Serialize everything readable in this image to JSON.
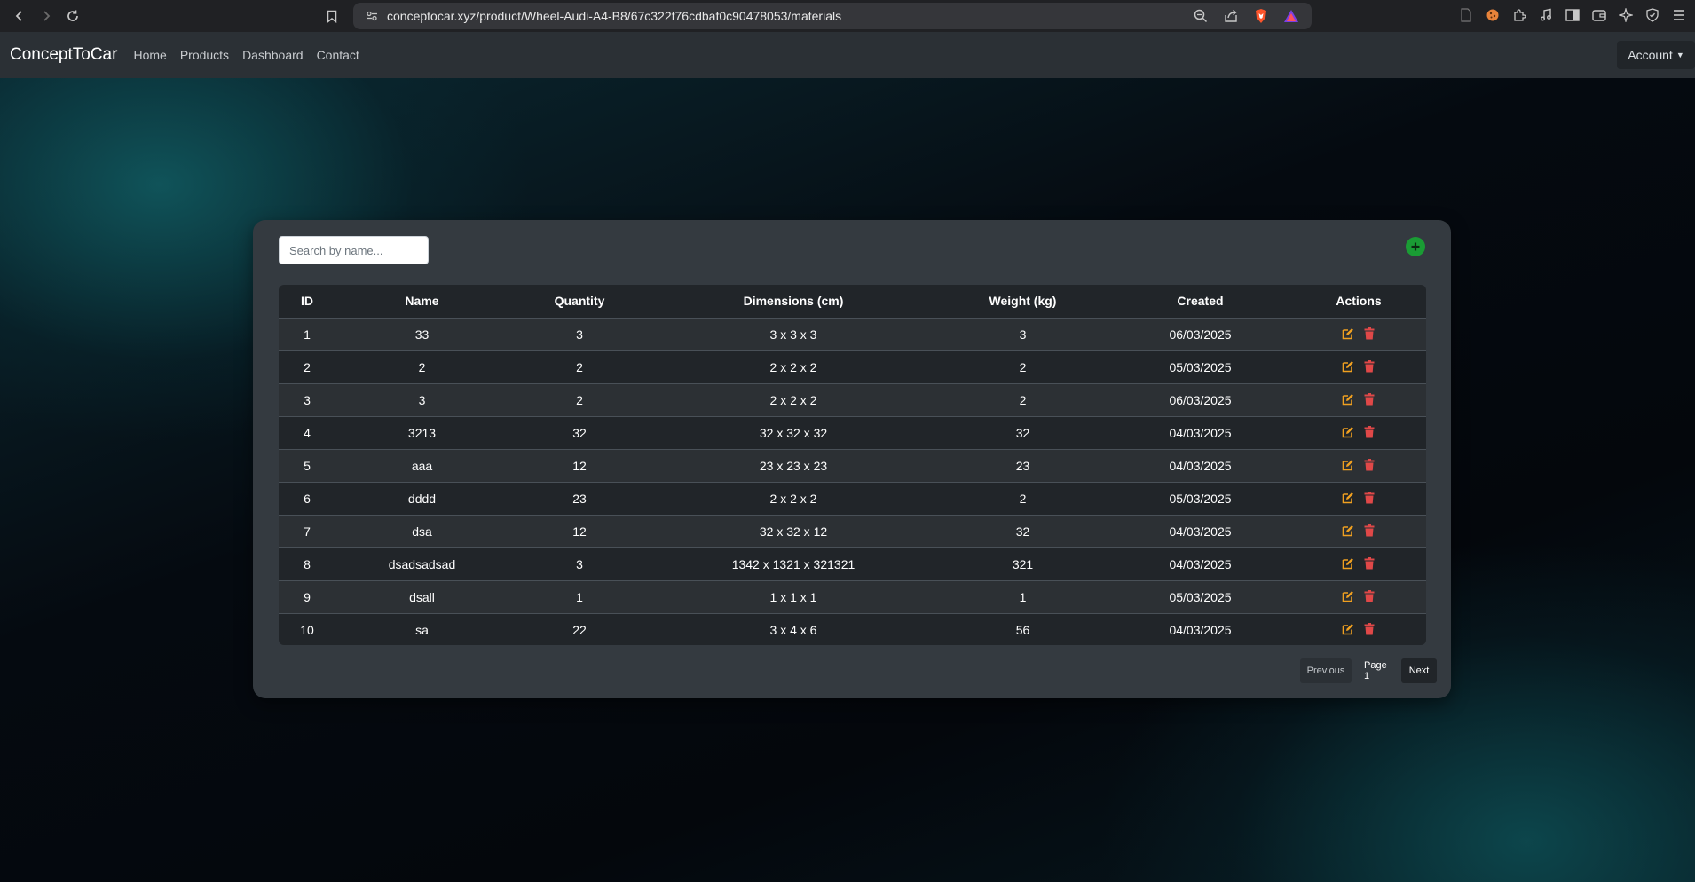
{
  "browser": {
    "url": "conceptocar.xyz/product/Wheel-Audi-A4-B8/67c322f76cdbaf0c90478053/materials"
  },
  "navbar": {
    "brand": "ConceptToCar",
    "links": [
      "Home",
      "Products",
      "Dashboard",
      "Contact"
    ],
    "account_label": "Account"
  },
  "materials": {
    "search_placeholder": "Search by name...",
    "columns": [
      "ID",
      "Name",
      "Quantity",
      "Dimensions (cm)",
      "Weight (kg)",
      "Created",
      "Actions"
    ],
    "rows": [
      {
        "id": "1",
        "name": "33",
        "quantity": "3",
        "dimensions": "3 x 3 x 3",
        "weight": "3",
        "created": "06/03/2025"
      },
      {
        "id": "2",
        "name": "2",
        "quantity": "2",
        "dimensions": "2 x 2 x 2",
        "weight": "2",
        "created": "05/03/2025"
      },
      {
        "id": "3",
        "name": "3",
        "quantity": "2",
        "dimensions": "2 x 2 x 2",
        "weight": "2",
        "created": "06/03/2025"
      },
      {
        "id": "4",
        "name": "3213",
        "quantity": "32",
        "dimensions": "32 x 32 x 32",
        "weight": "32",
        "created": "04/03/2025"
      },
      {
        "id": "5",
        "name": "aaa",
        "quantity": "12",
        "dimensions": "23 x 23 x 23",
        "weight": "23",
        "created": "04/03/2025"
      },
      {
        "id": "6",
        "name": "dddd",
        "quantity": "23",
        "dimensions": "2 x 2 x 2",
        "weight": "2",
        "created": "05/03/2025"
      },
      {
        "id": "7",
        "name": "dsa",
        "quantity": "12",
        "dimensions": "32 x 32 x 12",
        "weight": "32",
        "created": "04/03/2025"
      },
      {
        "id": "8",
        "name": "dsadsadsad",
        "quantity": "3",
        "dimensions": "1342 x 1321 x 321321",
        "weight": "321",
        "created": "04/03/2025"
      },
      {
        "id": "9",
        "name": "dsall",
        "quantity": "1",
        "dimensions": "1 x 1 x 1",
        "weight": "1",
        "created": "05/03/2025"
      },
      {
        "id": "10",
        "name": "sa",
        "quantity": "22",
        "dimensions": "3 x 4 x 6",
        "weight": "56",
        "created": "04/03/2025"
      }
    ],
    "pagination": {
      "previous_label": "Previous",
      "page_label": "Page 1",
      "next_label": "Next"
    }
  },
  "colors": {
    "edit_icon": "#f0a020",
    "delete_icon": "#e04848",
    "add_button": "#1a9c34"
  }
}
